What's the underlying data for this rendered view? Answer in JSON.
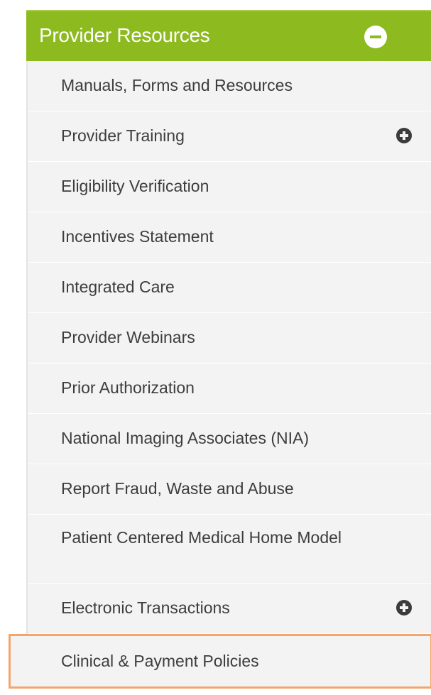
{
  "menu": {
    "header": {
      "label": "Provider Resources",
      "icon": "minus-circle-icon"
    },
    "items": [
      {
        "label": "Manuals, Forms and Resources"
      },
      {
        "label": "Provider Training",
        "icon": "plus-circle-icon"
      },
      {
        "label": "Eligibility Verification"
      },
      {
        "label": "Incentives Statement"
      },
      {
        "label": "Integrated Care"
      },
      {
        "label": "Provider Webinars"
      },
      {
        "label": "Prior Authorization"
      },
      {
        "label": "National Imaging Associates (NIA)"
      },
      {
        "label": "Report Fraud, Waste and Abuse"
      },
      {
        "label": "Patient Centered Medical Home Model"
      },
      {
        "label": "Electronic Transactions",
        "icon": "plus-circle-icon"
      },
      {
        "label": "Clinical & Payment Policies",
        "highlighted": true
      }
    ]
  },
  "colors": {
    "header_bg": "#8dba1e",
    "item_bg": "#f3f3f3",
    "item_text": "#3d3d3d",
    "highlight_border": "#f3a66b"
  }
}
